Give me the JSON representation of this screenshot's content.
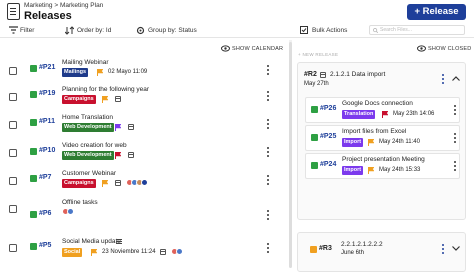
{
  "header": {
    "breadcrumb": "Marketing > Marketing Plan",
    "title": "Releases",
    "release_button": "+ Release"
  },
  "toolbar": {
    "filter": "Filter",
    "order_by": "Order by: Id",
    "group_by": "Group by: Status",
    "bulk_actions": "Bulk Actions",
    "search_placeholder": "Search Files..."
  },
  "links": {
    "show_calendar": "SHOW CALENDAR",
    "show_closed": "SHOW CLOSED",
    "new_release": "+ NEW RELEASE"
  },
  "rows": [
    {
      "id": "#P21",
      "title": "Mailing Webinar",
      "tag": "Mailings",
      "tag_color": "#1e3a8a",
      "date": "02 Mayo 11:09",
      "status_color": "#2ea043"
    },
    {
      "id": "#P19",
      "title": "Planning for the following year",
      "tag": "Campaigns",
      "tag_color": "#c8102e",
      "status_color": "#2ea043"
    },
    {
      "id": "#P11",
      "title": "Home Translation",
      "tag": "Web Development",
      "tag_color": "#2e7d32",
      "status_color": "#2ea043"
    },
    {
      "id": "#P10",
      "title": "Video creation for web",
      "tag": "Web Development",
      "tag_color": "#2e7d32",
      "status_color": "#2ea043"
    },
    {
      "id": "#P7",
      "title": "Customer Webinar",
      "tag": "Campaigns",
      "tag_color": "#c8102e",
      "status_color": "#2ea043"
    },
    {
      "id": "#P6",
      "title": "Offline tasks",
      "status_color": "#2ea043"
    },
    {
      "id": "#P5",
      "title": "Social Media update",
      "tag": "Social",
      "tag_color": "#f0a020",
      "date": "23 Noviembre 11:24",
      "status_color": "#2ea043"
    }
  ],
  "release_panel": {
    "id": "#R2",
    "version": "2.1.2.1 Data import",
    "date": "May 27th",
    "cards": [
      {
        "id": "#P26",
        "title": "Google Docs connection",
        "tag": "Translation",
        "tag_color": "#7c3aed",
        "date": "May 23th 14:06"
      },
      {
        "id": "#P25",
        "title": "Import files from Excel",
        "tag": "Import",
        "tag_color": "#7c3aed",
        "date": "May 24th 11:40"
      },
      {
        "id": "#P24",
        "title": "Project presentation Meeting",
        "tag": "Import",
        "tag_color": "#7c3aed",
        "date": "May 24th 15:33"
      }
    ]
  },
  "release_panel_2": {
    "id": "#R3",
    "version": "2.2.1.2.1.2.2.2",
    "date": "June 6th"
  },
  "colors": {
    "accent": "#1e3f9a",
    "done": "#2ea043"
  }
}
